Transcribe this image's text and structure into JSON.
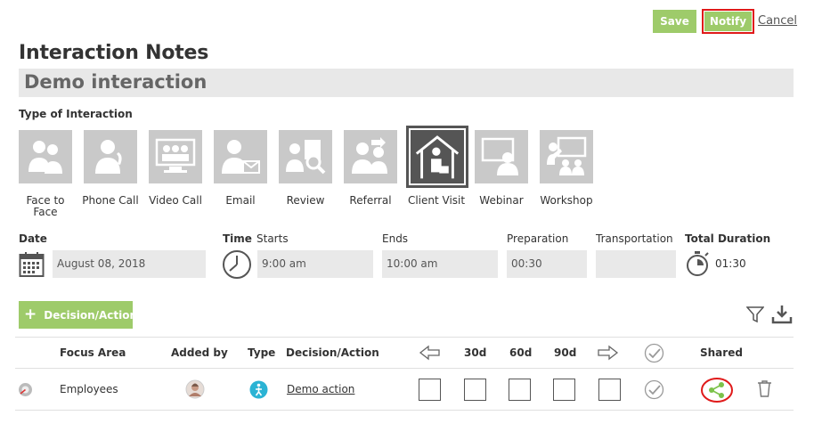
{
  "header": {
    "save_label": "Save",
    "notify_label": "Notify",
    "cancel_label": "Cancel",
    "title": "Interaction Notes",
    "interaction_name": "Demo interaction"
  },
  "type_section": {
    "label": "Type of Interaction",
    "selected": "Client Visit",
    "types": [
      {
        "label": "Face to Face",
        "icon": "face-to-face-icon"
      },
      {
        "label": "Phone Call",
        "icon": "phone-call-icon"
      },
      {
        "label": "Video Call",
        "icon": "video-call-icon"
      },
      {
        "label": "Email",
        "icon": "email-icon"
      },
      {
        "label": "Review",
        "icon": "review-icon"
      },
      {
        "label": "Referral",
        "icon": "referral-icon"
      },
      {
        "label": "Client Visit",
        "icon": "client-visit-icon"
      },
      {
        "label": "Webinar",
        "icon": "webinar-icon"
      },
      {
        "label": "Workshop",
        "icon": "workshop-icon"
      }
    ]
  },
  "schedule": {
    "date_label": "Date",
    "date_value": "August 08, 2018",
    "time_label": "Time",
    "starts_label": "Starts",
    "starts_value": "9:00 am",
    "ends_label": "Ends",
    "ends_value": "10:00 am",
    "preparation_label": "Preparation",
    "preparation_value": "00:30",
    "transportation_label": "Transportation",
    "transportation_value": "",
    "total_duration_label": "Total Duration",
    "total_duration_value": "01:30"
  },
  "actions": {
    "add_label": "Decision/Action",
    "columns": {
      "focus_area": "Focus Area",
      "added_by": "Added by",
      "type": "Type",
      "decision_action": "Decision/Action",
      "d30": "30d",
      "d60": "60d",
      "d90": "90d",
      "shared": "Shared"
    },
    "rows": [
      {
        "focus_area": "Employees",
        "decision_action": "Demo action"
      }
    ]
  },
  "colors": {
    "accent_green": "#9ecb6a",
    "highlight_red": "#e01a1a",
    "type_teal": "#2bb3d4",
    "share_green": "#7cc24a"
  }
}
